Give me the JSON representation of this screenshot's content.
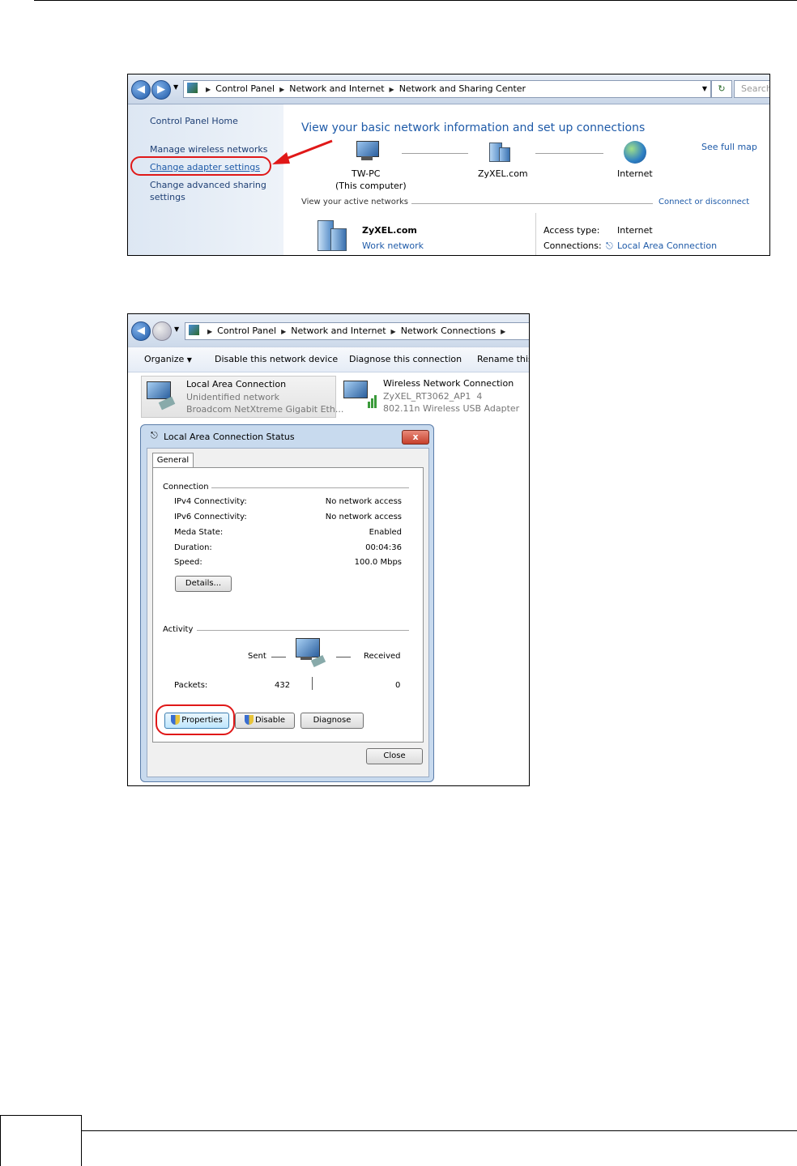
{
  "screen1": {
    "breadcrumb": [
      "Control Panel",
      "Network and Internet",
      "Network and Sharing Center"
    ],
    "search_placeholder": "Search",
    "sidebar": {
      "home": "Control Panel Home",
      "manage_wireless": "Manage wireless networks",
      "change_adapter": "Change adapter settings",
      "change_sharing_1": "Change advanced sharing",
      "change_sharing_2": "settings"
    },
    "heading": "View your basic network information and set up connections",
    "see_full_map": "See full map",
    "map": {
      "pc_name": "TW-PC",
      "pc_sub": "(This computer)",
      "network": "ZyXEL.com",
      "internet": "Internet"
    },
    "active_networks": "View your active networks",
    "connect_disconnect": "Connect or disconnect",
    "active": {
      "name": "ZyXEL.com",
      "type": "Work network",
      "access_label": "Access type:",
      "access_value": "Internet",
      "conn_label": "Connections:",
      "conn_value": "Local Area Connection"
    }
  },
  "screen2": {
    "breadcrumb": [
      "Control Panel",
      "Network and Internet",
      "Network Connections"
    ],
    "toolbar": {
      "organize": "Organize",
      "disable": "Disable this network device",
      "diagnose": "Diagnose this connection",
      "rename": "Rename this"
    },
    "adapters": [
      {
        "name": "Local Area Connection",
        "status": "Unidentified network",
        "device": "Broadcom NetXtreme Gigabit Eth..."
      },
      {
        "name": "Wireless Network Connection",
        "status": "ZyXEL_RT3062_AP1  4",
        "device": "802.11n Wireless USB Adapter"
      }
    ],
    "dialog": {
      "title": "Local Area Connection Status",
      "close_glyph": "x",
      "tab": "General",
      "connection_group": "Connection",
      "rows": [
        {
          "label": "IPv4 Connectivity:",
          "value": "No network access"
        },
        {
          "label": "IPv6 Connectivity:",
          "value": "No network access"
        },
        {
          "label": "Meda State:",
          "value": "Enabled"
        },
        {
          "label": "Duration:",
          "value": "00:04:36"
        },
        {
          "label": "Speed:",
          "value": "100.0 Mbps"
        }
      ],
      "details_btn": "Details...",
      "activity_group": "Activity",
      "sent": "Sent",
      "received": "Received",
      "packets_label": "Packets:",
      "packets_sent": "432",
      "packets_received": "0",
      "properties_btn": "Properties",
      "disable_btn": "Disable",
      "diagnose_btn": "Diagnose",
      "close_btn": "Close"
    }
  }
}
